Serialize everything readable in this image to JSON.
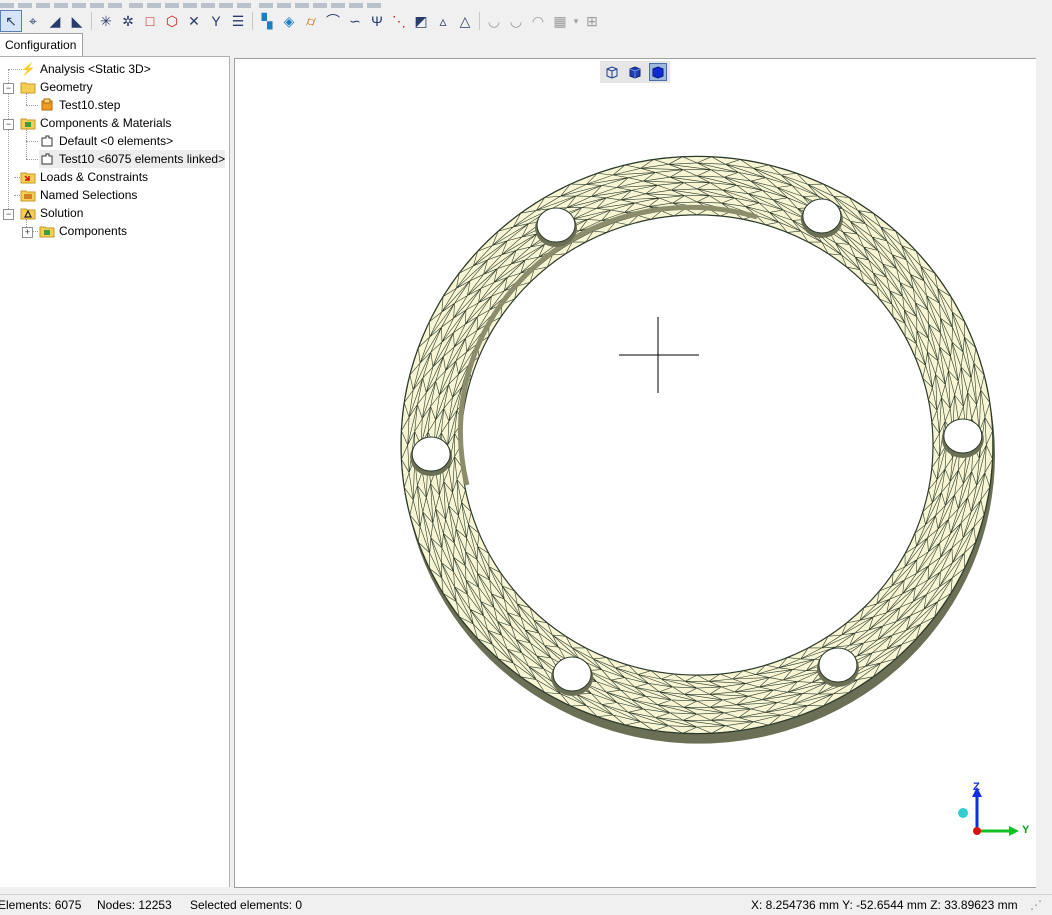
{
  "tabs": {
    "configuration": "Configuration"
  },
  "toolbar": {
    "icons": [
      "select-arrow-icon",
      "select-node-icon",
      "select-edge-icon",
      "select-face-icon",
      "explode-icon",
      "explode-part-icon",
      "rectangle-icon",
      "cube-icon",
      "close-x-icon",
      "y-split-icon",
      "grid-lines-icon",
      "component-a-icon",
      "component-b-icon",
      "cylinder-icon",
      "arch-icon",
      "curve-icon",
      "y-fork-icon",
      "dots-icon",
      "load-icon",
      "triangle-a-icon",
      "triangle-icon",
      "smooth-a-icon",
      "smooth-b-icon",
      "smooth-c-icon",
      "film-icon",
      "table-icon"
    ]
  },
  "tree": {
    "items": [
      {
        "label": "Analysis <Static 3D>",
        "icon": "lightning-icon"
      },
      {
        "label": "Geometry",
        "icon": "folder-icon"
      },
      {
        "label": "Test10.step",
        "icon": "step-file-icon"
      },
      {
        "label": "Components & Materials",
        "icon": "components-icon"
      },
      {
        "label": "Default <0 elements>",
        "icon": "component-piece-icon"
      },
      {
        "label": "Test10 <6075 elements linked>",
        "icon": "component-piece-icon"
      },
      {
        "label": "Loads & Constraints",
        "icon": "loads-icon"
      },
      {
        "label": "Named Selections",
        "icon": "named-selection-icon"
      },
      {
        "label": "Solution",
        "icon": "solution-icon"
      },
      {
        "label": "Components",
        "icon": "components-icon"
      }
    ]
  },
  "viewport": {
    "view_modes": [
      "wireframe-cube-icon",
      "solid-cube-icon",
      "shaded-cube-icon"
    ],
    "active_view_mode": 2,
    "mesh_fill_color": "#f7f5d3",
    "mesh_line_color": "#2b3a2b",
    "axis": {
      "z_label": "Z",
      "y_label": "Y"
    }
  },
  "status": {
    "elements": "Elements: 6075",
    "nodes": "Nodes: 12253",
    "selected": "Selected elements: 0",
    "coords": "X: 8.254736 mm Y: -52.6544 mm Z: 33.89623 mm"
  }
}
